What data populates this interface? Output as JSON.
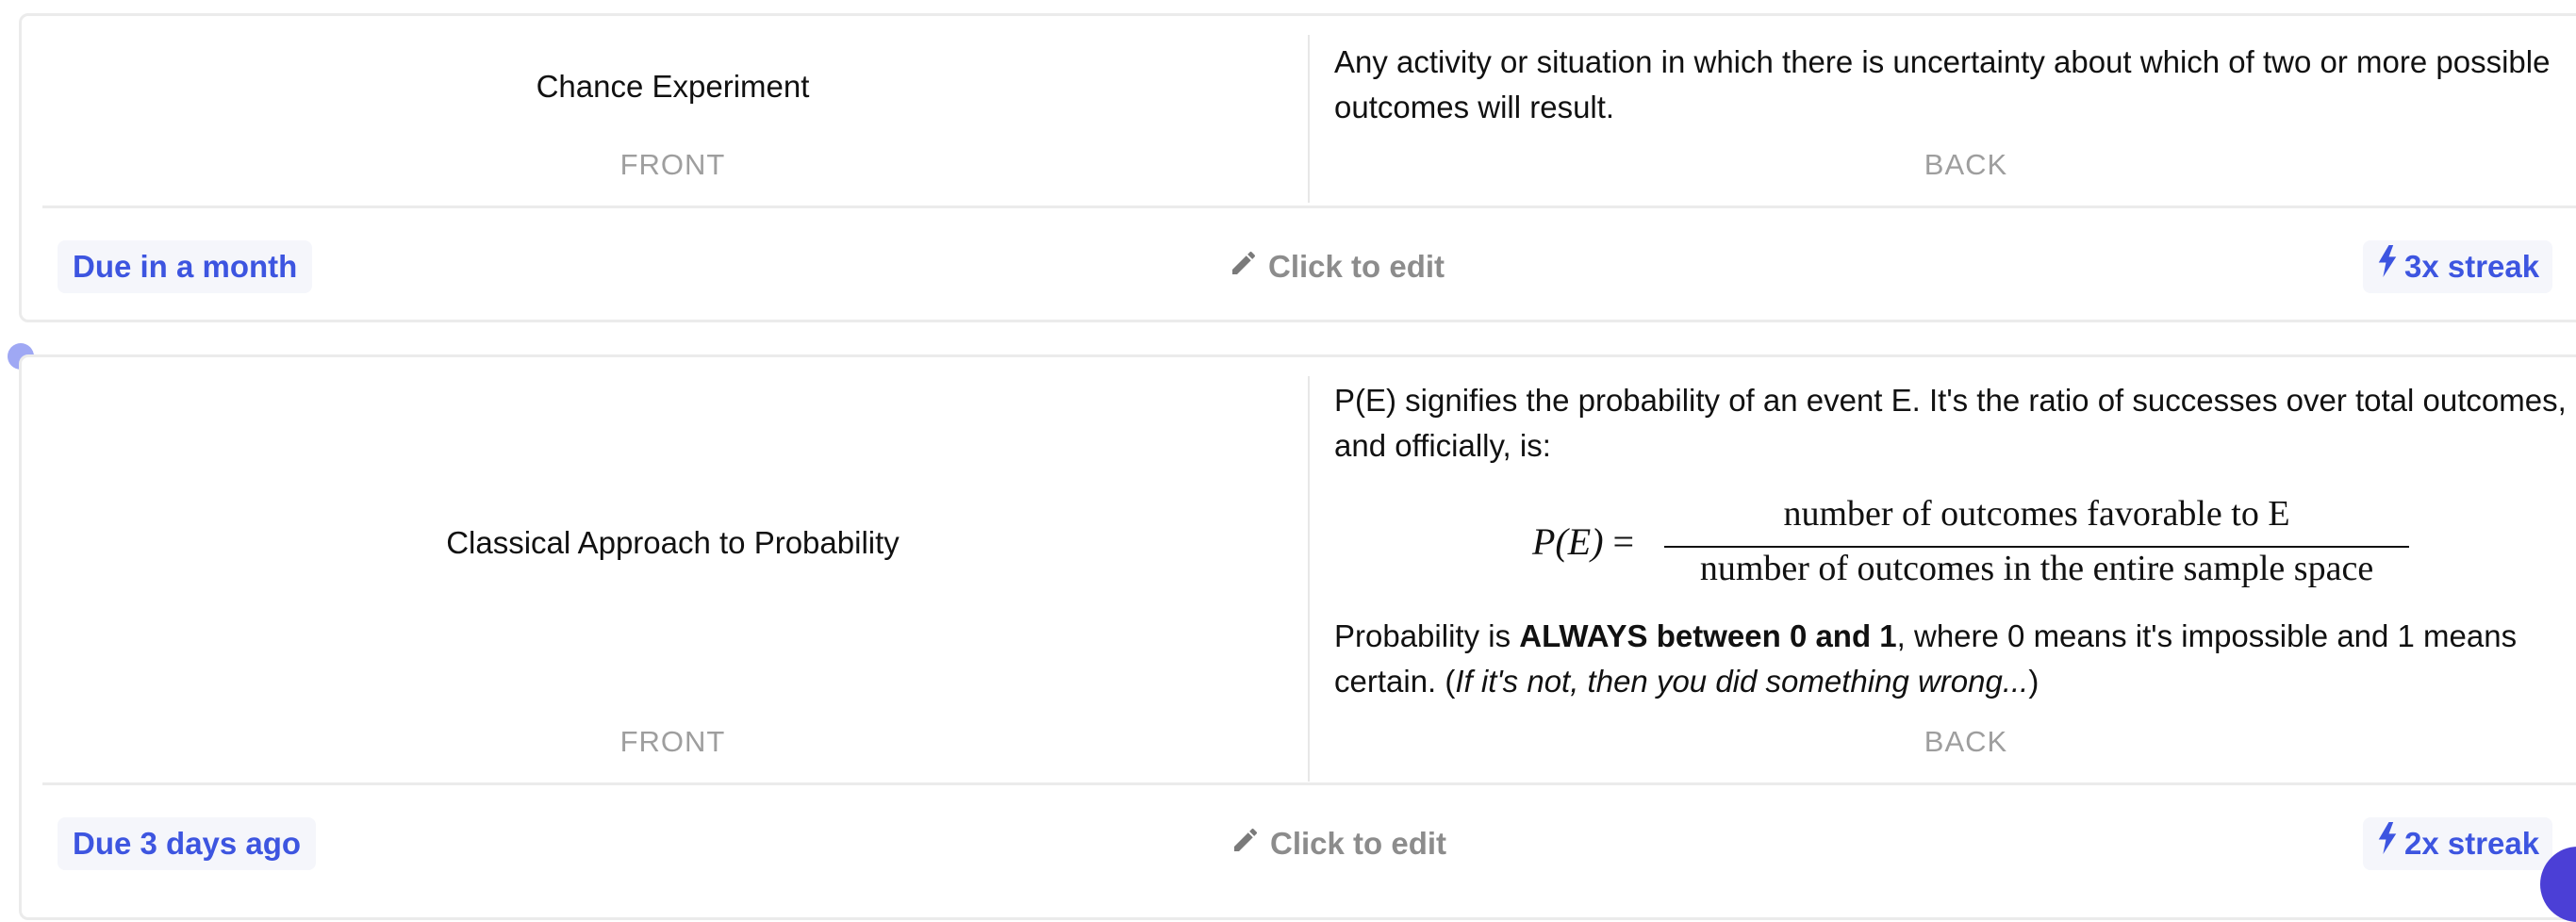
{
  "cards": [
    {
      "front_text": "Chance Experiment",
      "front_label": "FRONT",
      "back_text": "Any activity or situation in which there is uncertainty about which of two or more possible outcomes will result.",
      "back_label": "BACK",
      "due": "Due in a month",
      "edit": "Click to edit",
      "streak": "3x streak"
    },
    {
      "front_text": "Classical Approach to Probability",
      "front_label": "FRONT",
      "back_intro": "P(E) signifies the probability of an event E. It's the ratio of successes over total outcomes, and officially, is:",
      "formula": {
        "lhs": "P(E)",
        "eq": "=",
        "numerator": "number of outcomes favorable to E",
        "denominator": "number of outcomes in the entire sample space"
      },
      "back_outro_start": "Probability is ",
      "back_outro_bold": "ALWAYS between 0 and 1",
      "back_outro_mid": ", where 0 means it's impossible and 1 means certain. (",
      "back_outro_italic": "If it's not, then you did something wrong...",
      "back_outro_end": ")",
      "back_label": "BACK",
      "due": "Due 3 days ago",
      "edit": "Click to edit",
      "streak": "2x streak"
    }
  ],
  "icons": {
    "edit": "pencil-icon",
    "streak": "lightning-bolt-icon"
  },
  "colors": {
    "accent": "#3d55e0",
    "badge_bg": "#f5f6fb",
    "muted": "#9e9e9e"
  }
}
